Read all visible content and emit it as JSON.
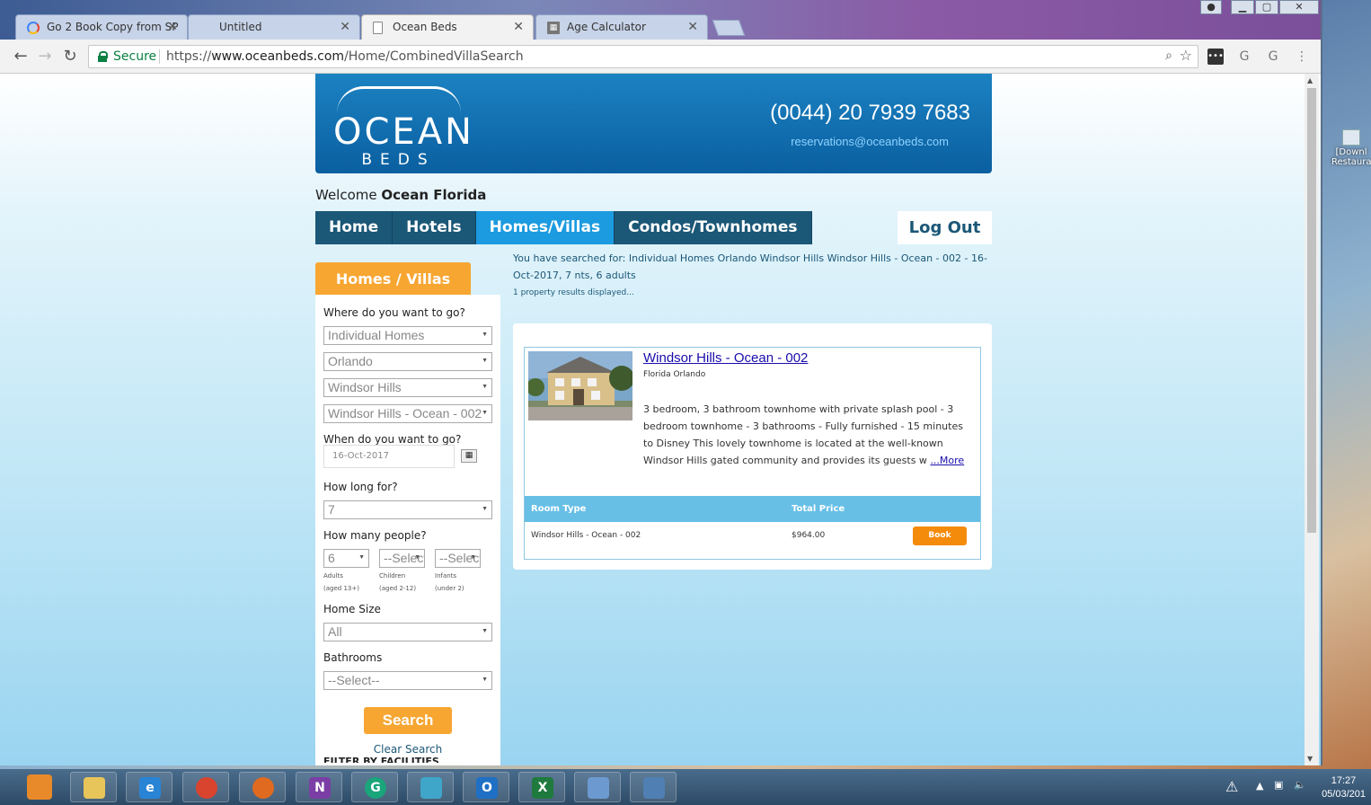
{
  "browser": {
    "tabs": [
      {
        "label": "Go 2 Book Copy from SP",
        "icon": "google-drive-icon"
      },
      {
        "label": "Untitled",
        "icon": "blank-page-icon"
      },
      {
        "label": "Ocean Beds",
        "icon": "document-icon",
        "active": true
      },
      {
        "label": "Age Calculator",
        "icon": "calculator-icon"
      }
    ],
    "secure_label": "Secure",
    "url_scheme": "https://",
    "url_host": "www.oceanbeds.com",
    "url_path": "/Home/CombinedVillaSearch"
  },
  "header": {
    "logo_top": "OCEAN",
    "logo_bottom": "BEDS",
    "phone": "(0044) 20 7939 7683",
    "email": "reservations@oceanbeds.com"
  },
  "welcome": {
    "prefix": "Welcome",
    "name": "Ocean Florida"
  },
  "nav": {
    "items": [
      "Home",
      "Hotels",
      "Homes/Villas",
      "Condos/Townhomes"
    ],
    "active": "Homes/Villas",
    "logout": "Log Out"
  },
  "sidebar": {
    "tab_title": "Homes / Villas",
    "where_label": "Where do you want to go?",
    "type_value": "Individual Homes",
    "city_value": "Orlando",
    "area_value": "Windsor Hills",
    "property_value": "Windsor Hills - Ocean - 002",
    "when_label": "When do you want to go?",
    "date_value": "16-Oct-2017",
    "howlong_label": "How long for?",
    "nights_value": "7",
    "people_label": "How many people?",
    "adults_value": "6",
    "children_value": "--Select--",
    "infants_value": "--Select--",
    "adults_label": "Adults",
    "adults_sub": "(aged 13+)",
    "children_label": "Children",
    "children_sub": "(aged 2-12)",
    "infants_label": "Infants",
    "infants_sub": "(under 2)",
    "homesize_label": "Home Size",
    "homesize_value": "All",
    "bathrooms_label": "Bathrooms",
    "bathrooms_value": "--Select--",
    "search_button": "Search",
    "clear_link": "Clear Search",
    "filter_heading": "FILTER BY FACILITIES"
  },
  "results": {
    "searched_text": "You have searched for: Individual Homes Orlando Windsor Hills Windsor Hills - Ocean - 002 - 16-Oct-2017, 7 nts, 6 adults",
    "count_text": "1 property results displayed...",
    "property": {
      "title": "Windsor Hills - Ocean - 002",
      "location": "Florida Orlando",
      "description": "3 bedroom, 3 bathroom townhome with private splash pool - 3 bedroom townhome - 3 bathrooms - Fully furnished - 15 minutes to Disney This lovely townhome is located at the well-known Windsor Hills gated community and provides its guests w",
      "more_link": "...More"
    },
    "table": {
      "col_room_type": "Room Type",
      "col_total_price": "Total Price",
      "rows": [
        {
          "room_type": "Windsor Hills - Ocean - 002",
          "price": "$964.00",
          "action": "Book"
        }
      ]
    }
  },
  "desktop": {
    "icon_label_1": "[Downl",
    "icon_label_2": "Restaura"
  },
  "taskbar": {
    "apps": [
      "media-player-icon",
      "file-explorer-icon",
      "internet-explorer-icon",
      "chrome-icon",
      "firefox-icon",
      "onenote-icon",
      "grammarly-icon",
      "app-icon",
      "outlook-icon",
      "excel-icon",
      "photo-viewer-icon",
      "remote-desktop-icon"
    ],
    "time": "17:27",
    "date": "05/03/201"
  }
}
